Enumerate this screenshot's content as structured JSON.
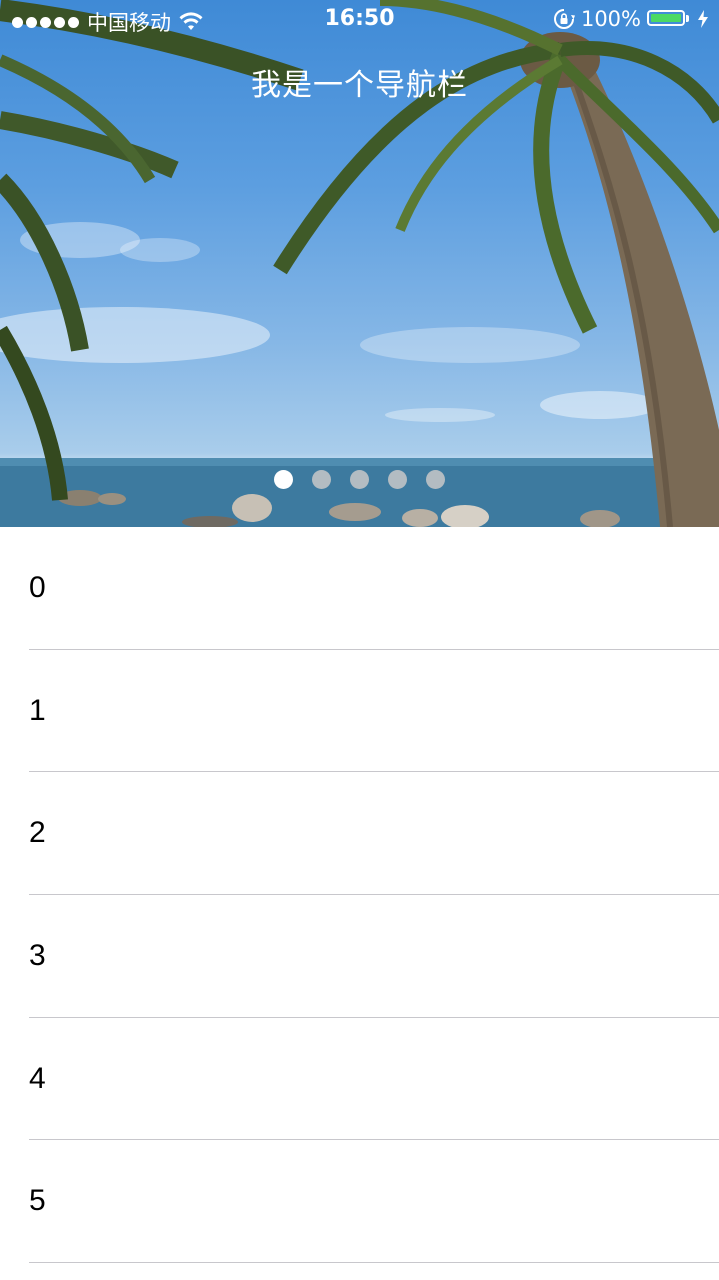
{
  "status_bar": {
    "carrier": "中国移动",
    "time": "16:50",
    "battery_percent": "100%",
    "battery_level": 1.0,
    "icons": [
      "signal-dots-icon",
      "wifi-icon",
      "rotation-lock-icon",
      "battery-icon",
      "charging-icon"
    ]
  },
  "nav": {
    "title": "我是一个导航栏"
  },
  "banner": {
    "page_count": 5,
    "current_page": 1
  },
  "list": {
    "items": [
      {
        "label": "0"
      },
      {
        "label": "1"
      },
      {
        "label": "2"
      },
      {
        "label": "3"
      },
      {
        "label": "4"
      },
      {
        "label": "5"
      }
    ]
  },
  "colors": {
    "battery_fill": "#4cd964",
    "separator": "#c8c7cc",
    "page_dot_active": "#ffffff",
    "page_dot_inactive": "#c8c8c8"
  }
}
